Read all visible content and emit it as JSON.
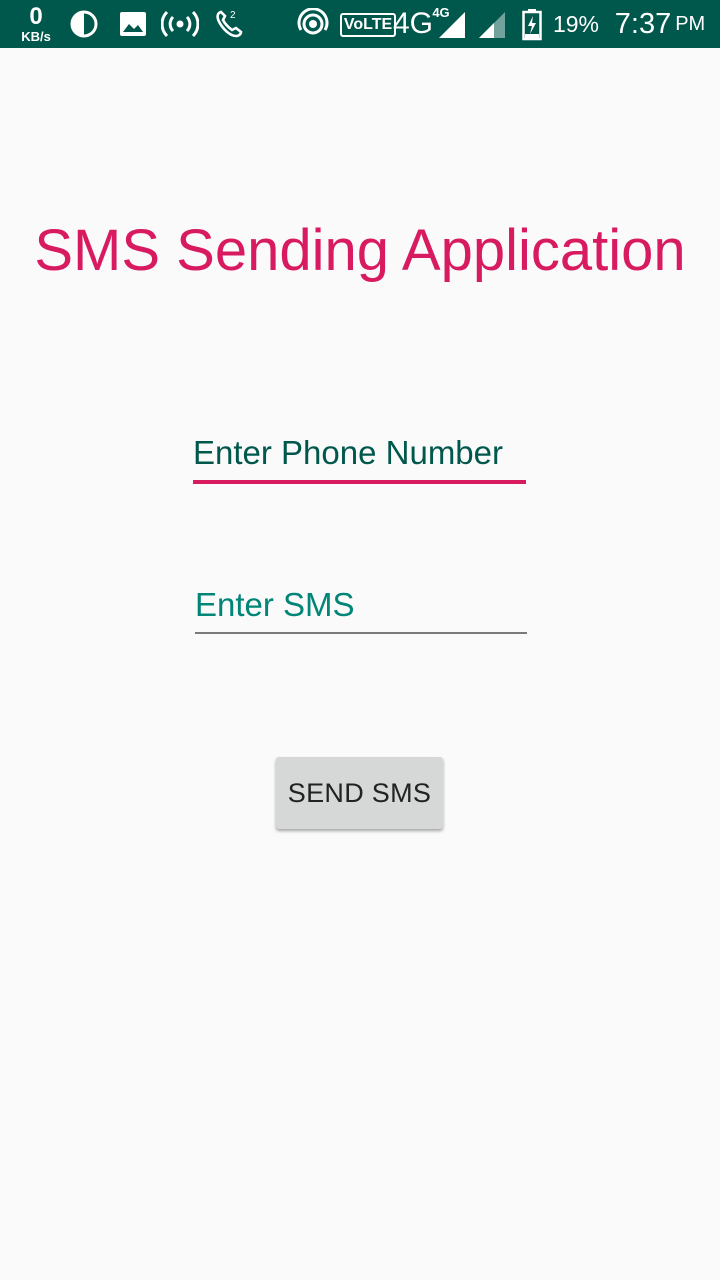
{
  "status_bar": {
    "net_speed_value": "0",
    "net_speed_unit": "KB/s",
    "icons": [
      "data-saver-icon",
      "gallery-icon",
      "hotspot-icon",
      "call-icon",
      "wifi-calling-icon",
      "volte-icon",
      "signal-icon",
      "signal-icon-2",
      "battery-charging-icon"
    ],
    "volte_label": "VoLTE",
    "network_label": "4G",
    "network_label_small": "4G",
    "battery": "19%",
    "time": "7:37",
    "ampm": "PM",
    "bg_color": "#00574b"
  },
  "app": {
    "title": "SMS Sending Application",
    "phone_placeholder": "Enter Phone Number",
    "sms_placeholder": "Enter SMS",
    "send_button_label": "SEND SMS",
    "accent_color": "#d81b60",
    "primary_dark": "#00574b",
    "primary": "#008577"
  }
}
